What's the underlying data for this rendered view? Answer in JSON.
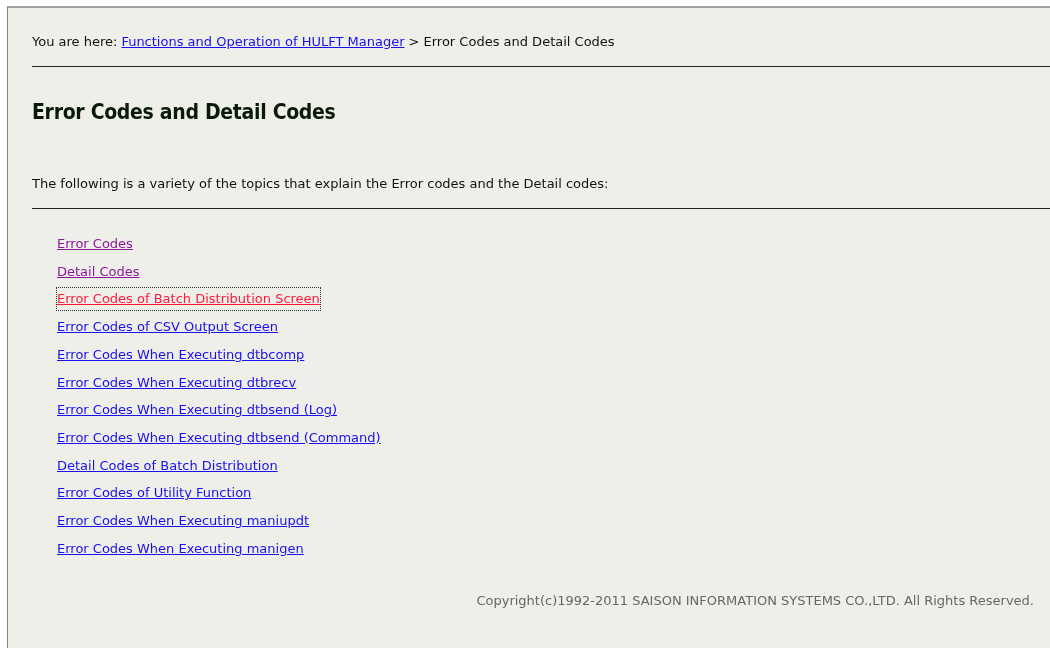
{
  "breadcrumb": {
    "label": "You are here:",
    "link": "Functions and Operation of HULFT Manager ",
    "current": "> Error Codes and Detail Codes"
  },
  "heading": "Error Codes and Detail Codes",
  "intro": "The following is a variety of the topics that explain the Error codes and the Detail codes:",
  "links": [
    {
      "text": "Error Codes",
      "visited": true,
      "focused": false
    },
    {
      "text": "Detail Codes",
      "visited": true,
      "focused": false
    },
    {
      "text": "Error Codes of Batch Distribution Screen",
      "visited": false,
      "focused": true
    },
    {
      "text": "Error Codes of CSV Output Screen",
      "visited": false,
      "focused": false
    },
    {
      "text": "Error Codes When Executing dtbcomp",
      "visited": false,
      "focused": false
    },
    {
      "text": "Error Codes When Executing dtbrecv",
      "visited": false,
      "focused": false
    },
    {
      "text": "Error Codes When Executing dtbsend (Log)",
      "visited": false,
      "focused": false
    },
    {
      "text": "Error Codes When Executing dtbsend (Command)",
      "visited": false,
      "focused": false
    },
    {
      "text": "Detail Codes of Batch Distribution",
      "visited": false,
      "focused": false
    },
    {
      "text": "Error Codes of Utility Function",
      "visited": false,
      "focused": false
    },
    {
      "text": "Error Codes When Executing maniupdt",
      "visited": false,
      "focused": false
    },
    {
      "text": "Error Codes When Executing manigen",
      "visited": false,
      "focused": false
    }
  ],
  "copyright": "Copyright(c)1992-2011 SAISON INFORMATION SYSTEMS CO.,LTD. All Rights Reserved."
}
